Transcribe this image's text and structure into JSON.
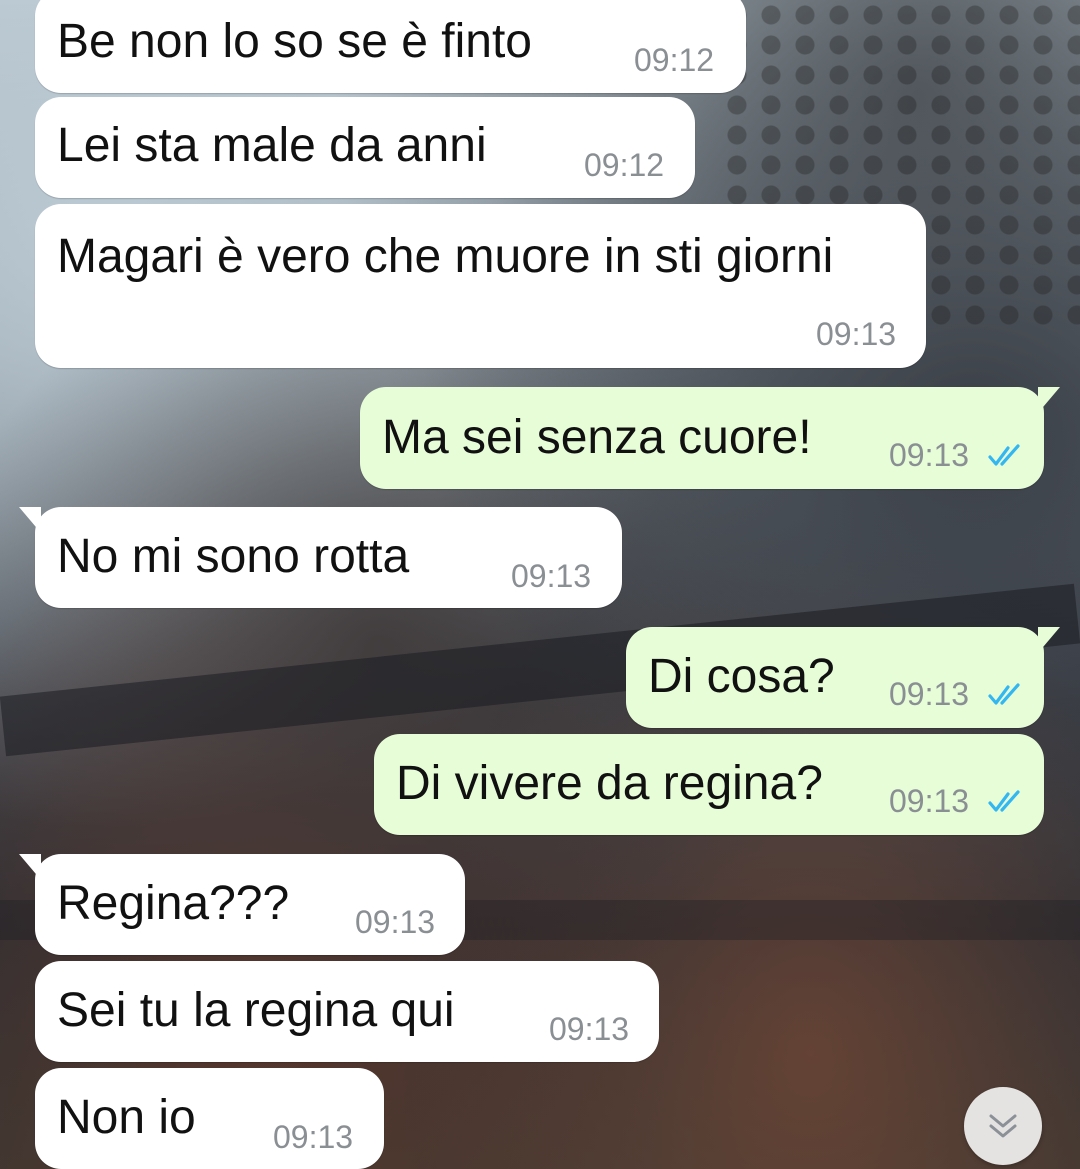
{
  "chat": {
    "messages": [
      {
        "direction": "in",
        "text": "Be non lo so se è finto",
        "time": "09:12"
      },
      {
        "direction": "in",
        "text": "Lei sta male da anni",
        "time": "09:12"
      },
      {
        "direction": "in",
        "text": "Magari è vero che muore in sti giorni",
        "time": "09:13"
      },
      {
        "direction": "out",
        "text": "Ma sei senza cuore!",
        "time": "09:13",
        "status": "read"
      },
      {
        "direction": "in",
        "text": "No mi sono rotta",
        "time": "09:13"
      },
      {
        "direction": "out",
        "text": "Di cosa?",
        "time": "09:13",
        "status": "read"
      },
      {
        "direction": "out",
        "text": "Di vivere da regina?",
        "time": "09:13",
        "status": "read"
      },
      {
        "direction": "in",
        "text": "Regina???",
        "time": "09:13"
      },
      {
        "direction": "in",
        "text": "Sei tu la regina qui",
        "time": "09:13"
      },
      {
        "direction": "in",
        "text": "Non io",
        "time": "09:13"
      }
    ]
  },
  "icons": {
    "read_ticks": "double-check-icon",
    "scroll_down": "double-chevron-down-icon"
  },
  "colors": {
    "incoming_bubble": "#ffffff",
    "outgoing_bubble": "#e7fdd8",
    "timestamp": "#8a8f93",
    "read_ticks": "#34b7f1"
  }
}
